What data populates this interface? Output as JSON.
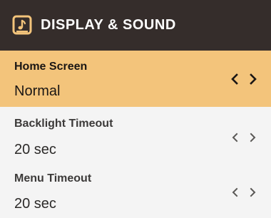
{
  "header": {
    "title": "DISPLAY & SOUND",
    "icon": "display-sound-icon",
    "background_color": "#352d2b",
    "icon_color": "#f3c47b"
  },
  "settings": [
    {
      "label": "Home Screen",
      "value": "Normal",
      "selected": true
    },
    {
      "label": "Backlight Timeout",
      "value": "20 sec",
      "selected": false
    },
    {
      "label": "Menu Timeout",
      "value": "20 sec",
      "selected": false
    }
  ],
  "colors": {
    "selected_row": "#f3c47b",
    "row_background": "#f4f4f4",
    "arrow_selected": "#1a1614",
    "arrow_default": "#5a5856"
  },
  "icons": {
    "prev": "chevron-left-icon",
    "next": "chevron-right-icon"
  }
}
